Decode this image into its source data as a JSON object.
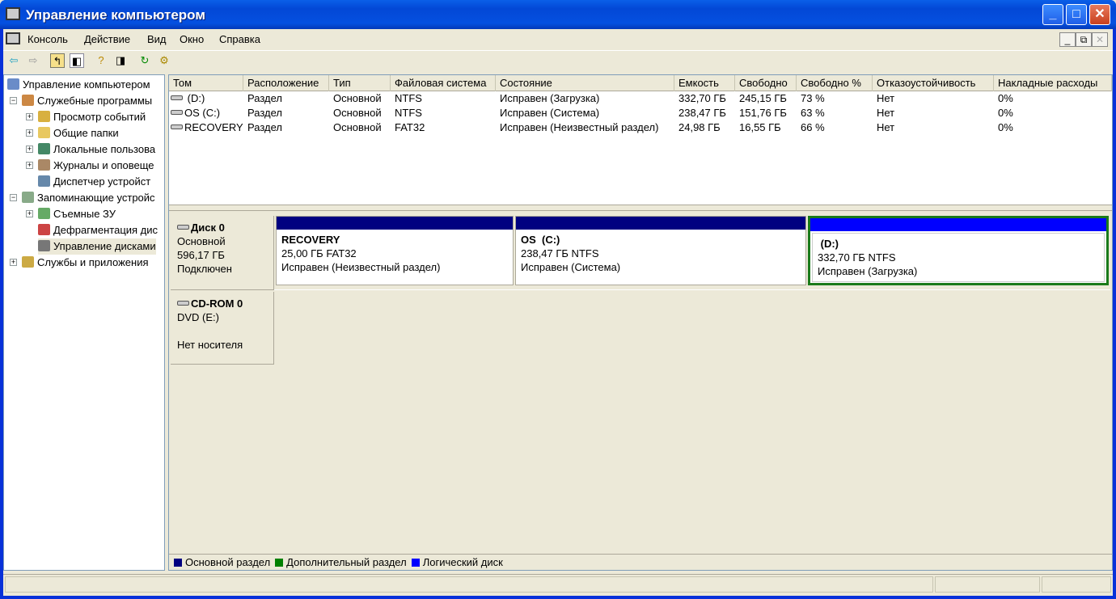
{
  "window": {
    "title": "Управление компьютером"
  },
  "menu": [
    "Консоль",
    "Действие",
    "Вид",
    "Окно",
    "Справка"
  ],
  "tree": [
    {
      "label": "Управление компьютером",
      "level": 0,
      "exp": ""
    },
    {
      "label": "Служебные программы",
      "level": 1,
      "exp": "-"
    },
    {
      "label": "Просмотр событий",
      "level": 2,
      "exp": "+"
    },
    {
      "label": "Общие папки",
      "level": 2,
      "exp": "+"
    },
    {
      "label": "Локальные пользова",
      "level": 2,
      "exp": "+"
    },
    {
      "label": "Журналы и оповеще",
      "level": 2,
      "exp": "+"
    },
    {
      "label": "Диспетчер устройст",
      "level": 2,
      "exp": ""
    },
    {
      "label": "Запоминающие устройс",
      "level": 1,
      "exp": "-"
    },
    {
      "label": "Съемные ЗУ",
      "level": 2,
      "exp": "+"
    },
    {
      "label": "Дефрагментация дис",
      "level": 2,
      "exp": ""
    },
    {
      "label": "Управление дисками",
      "level": 2,
      "exp": ""
    },
    {
      "label": "Службы и приложения",
      "level": 1,
      "exp": "+"
    }
  ],
  "table": {
    "columns": [
      "Том",
      "Расположение",
      "Тип",
      "Файловая система",
      "Состояние",
      "Емкость",
      "Свободно",
      "Свободно %",
      "Отказоустойчивость",
      "Накладные расходы"
    ],
    "rows": [
      [
        " (D:)",
        "Раздел",
        "Основной",
        "NTFS",
        "Исправен (Загрузка)",
        "332,70 ГБ",
        "245,15 ГБ",
        "73 %",
        "Нет",
        "0%"
      ],
      [
        "OS (C:)",
        "Раздел",
        "Основной",
        "NTFS",
        "Исправен (Система)",
        "238,47 ГБ",
        "151,76 ГБ",
        "63 %",
        "Нет",
        "0%"
      ],
      [
        "RECOVERY",
        "Раздел",
        "Основной",
        "FAT32",
        "Исправен (Неизвестный раздел)",
        "24,98 ГБ",
        "16,55 ГБ",
        "66 %",
        "Нет",
        "0%"
      ]
    ]
  },
  "disks": [
    {
      "name": "Диск 0",
      "type": "Основной",
      "size": "596,17 ГБ",
      "state": "Подключен",
      "partitions": [
        {
          "name": "RECOVERY",
          "info": "25,00 ГБ FAT32",
          "status": "Исправен (Неизвестный раздел)",
          "kind": "primary"
        },
        {
          "name": "OS  (C:)",
          "info": "238,47 ГБ NTFS",
          "status": "Исправен (Система)",
          "kind": "primary"
        },
        {
          "name": " (D:)",
          "info": "332,70 ГБ NTFS",
          "status": "Исправен (Загрузка)",
          "kind": "logical",
          "selected": true
        }
      ]
    },
    {
      "name": "CD-ROM 0",
      "type": "DVD (E:)",
      "state": "Нет носителя"
    }
  ],
  "legend": [
    {
      "label": "Основной раздел",
      "color": "#000080"
    },
    {
      "label": "Дополнительный раздел",
      "color": "#008000"
    },
    {
      "label": "Логический диск",
      "color": "#0000ff"
    }
  ]
}
